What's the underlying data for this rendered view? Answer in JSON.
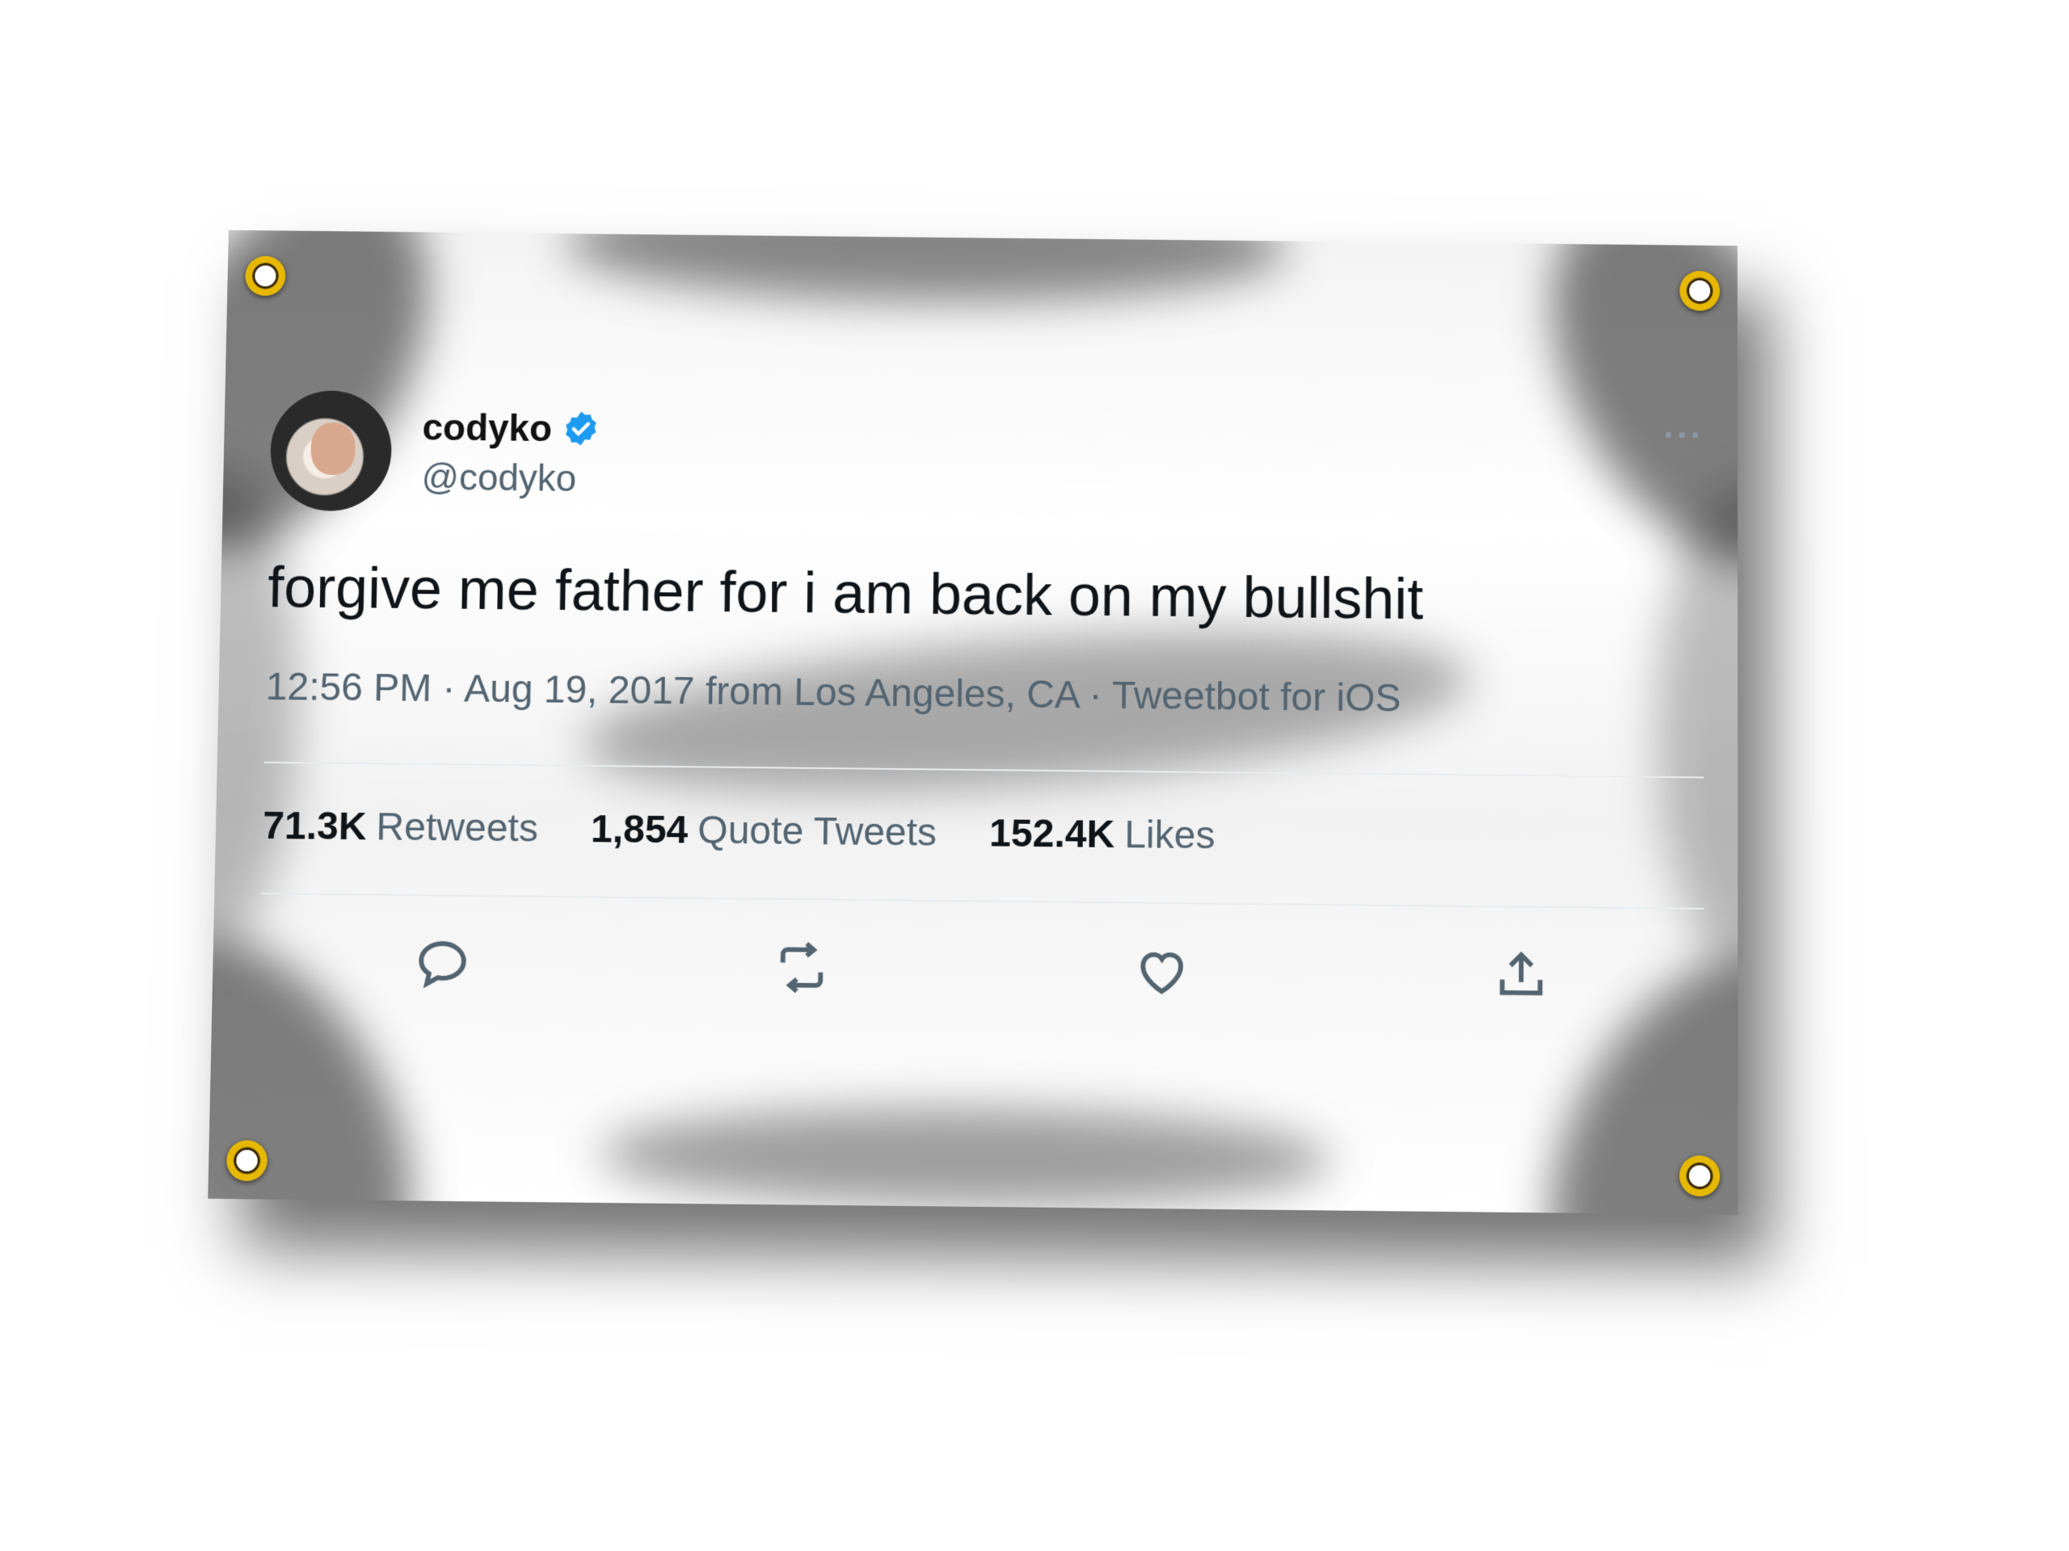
{
  "tweet": {
    "display_name": "codyko",
    "handle": "@codyko",
    "text": "forgive me father for i am back on my bullshit",
    "meta": "12:56 PM · Aug 19, 2017 from Los Angeles, CA · Tweetbot for iOS",
    "more": "···",
    "stats": [
      {
        "value": "71.3K",
        "label": "Retweets"
      },
      {
        "value": "1,854",
        "label": "Quote Tweets"
      },
      {
        "value": "152.4K",
        "label": "Likes"
      }
    ],
    "actions": [
      "reply-icon",
      "retweet-icon",
      "like-icon",
      "share-icon"
    ],
    "colors": {
      "verified": "#1d9bf0",
      "secondary_text": "#536471",
      "primary_text": "#0f1419"
    }
  }
}
